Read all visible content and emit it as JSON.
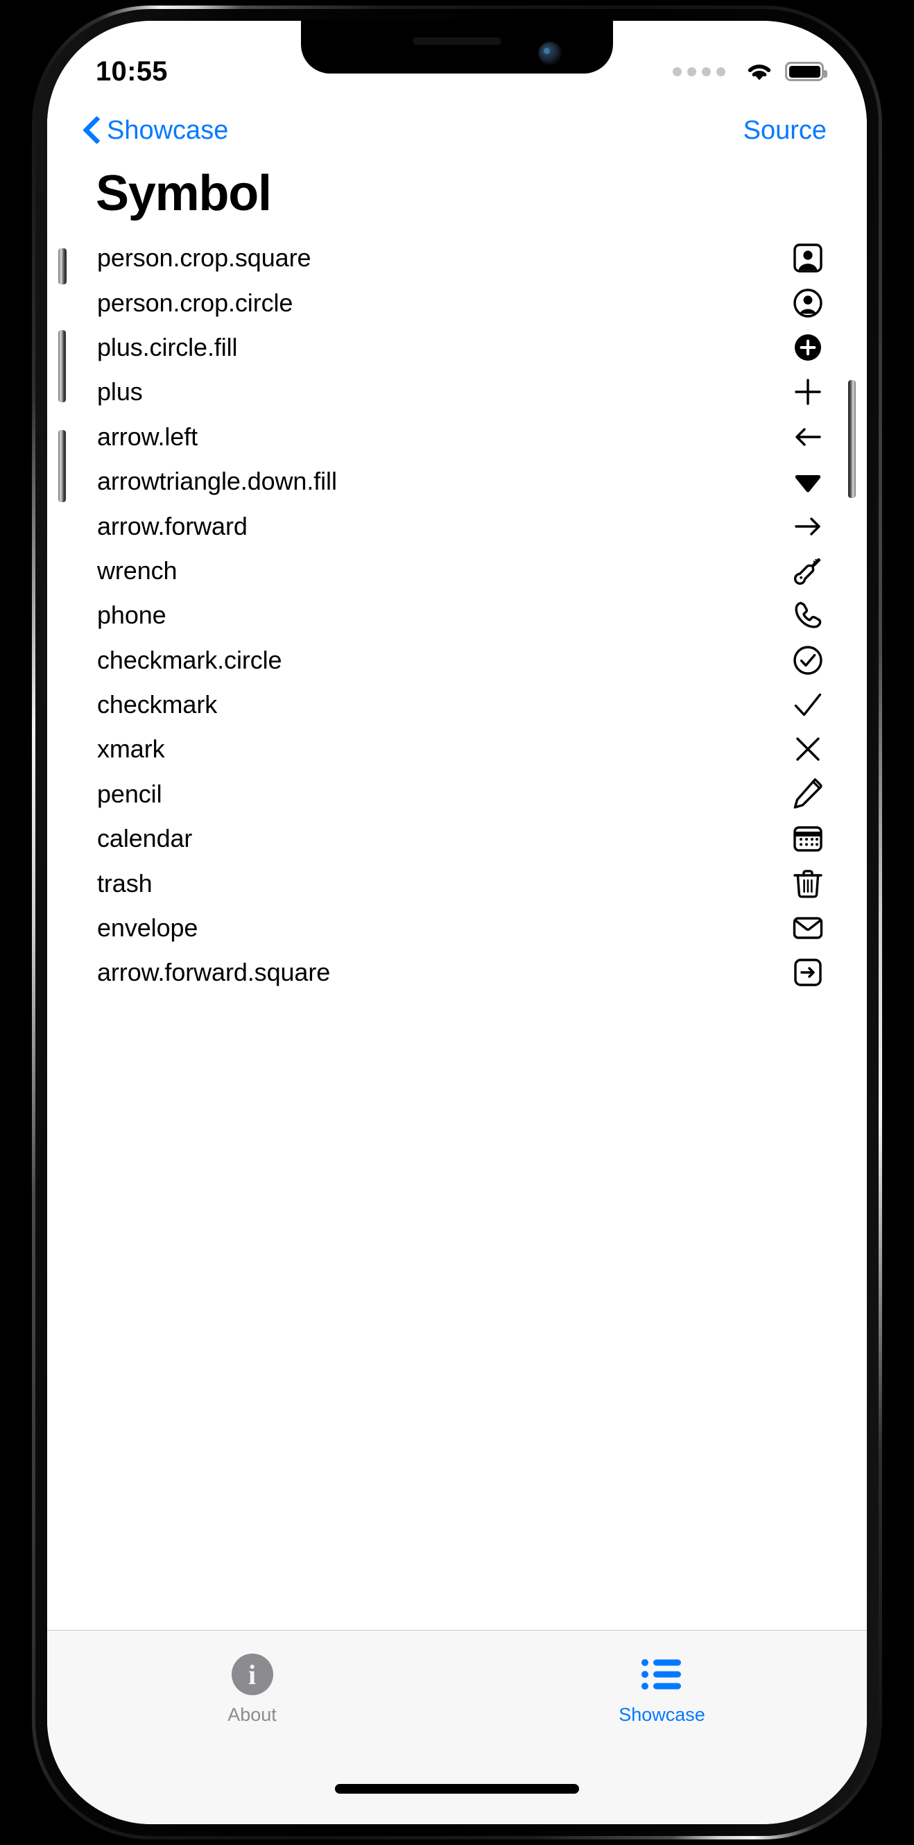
{
  "status_bar": {
    "time": "10:55",
    "cellular_icon": "cellular-dots-icon",
    "wifi_icon": "wifi-icon",
    "battery_icon": "battery-icon"
  },
  "nav_bar": {
    "back_icon": "chevron-left-icon",
    "back_label": "Showcase",
    "trailing_label": "Source"
  },
  "page_title": "Symbol",
  "accent_color": "#027aff",
  "list": {
    "rows": [
      {
        "label": "person.crop.square",
        "icon": "person-crop-square-icon"
      },
      {
        "label": "person.crop.circle",
        "icon": "person-crop-circle-icon"
      },
      {
        "label": "plus.circle.fill",
        "icon": "plus-circle-fill-icon"
      },
      {
        "label": "plus",
        "icon": "plus-icon"
      },
      {
        "label": "arrow.left",
        "icon": "arrow-left-icon"
      },
      {
        "label": "arrowtriangle.down.fill",
        "icon": "arrowtriangle-down-fill-icon"
      },
      {
        "label": "arrow.forward",
        "icon": "arrow-forward-icon"
      },
      {
        "label": "wrench",
        "icon": "wrench-icon"
      },
      {
        "label": "phone",
        "icon": "phone-icon"
      },
      {
        "label": "checkmark.circle",
        "icon": "checkmark-circle-icon"
      },
      {
        "label": "checkmark",
        "icon": "checkmark-icon"
      },
      {
        "label": "xmark",
        "icon": "xmark-icon"
      },
      {
        "label": "pencil",
        "icon": "pencil-icon"
      },
      {
        "label": "calendar",
        "icon": "calendar-icon"
      },
      {
        "label": "trash",
        "icon": "trash-icon"
      },
      {
        "label": "envelope",
        "icon": "envelope-icon"
      },
      {
        "label": "arrow.forward.square",
        "icon": "arrow-forward-square-icon"
      }
    ]
  },
  "tab_bar": {
    "tabs": [
      {
        "label": "About",
        "icon": "info-circle-fill-icon",
        "selected": false,
        "color": "#8b8b90"
      },
      {
        "label": "Showcase",
        "icon": "list-bullet-icon",
        "selected": true,
        "color": "#027aff"
      }
    ]
  }
}
